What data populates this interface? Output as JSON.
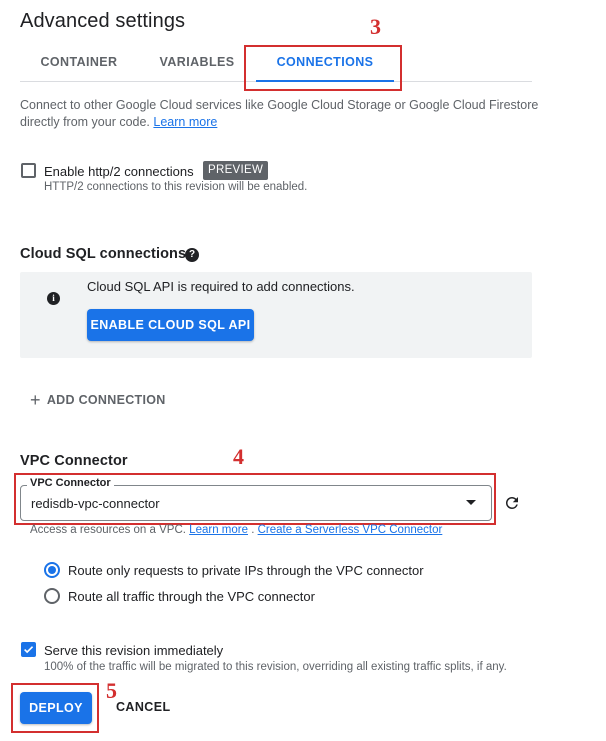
{
  "page": {
    "title": "Advanced settings"
  },
  "tabs": [
    {
      "label": "CONTAINER"
    },
    {
      "label": "VARIABLES"
    },
    {
      "label": "CONNECTIONS"
    }
  ],
  "connections": {
    "description": "Connect to other Google Cloud services like Google Cloud Storage or Google Cloud Firestore directly from your code.",
    "learn_more": "Learn more"
  },
  "http2": {
    "label": "Enable http/2 connections",
    "badge": "PREVIEW",
    "hint": "HTTP/2 connections to this revision will be enabled.",
    "checked": false
  },
  "cloud_sql": {
    "title": "Cloud SQL connections",
    "help_icon": "?",
    "info_icon": "i",
    "info_text": "Cloud SQL API is required to add connections.",
    "enable_button": "ENABLE CLOUD SQL API",
    "add_connection": "ADD CONNECTION",
    "add_icon": "+"
  },
  "vpc": {
    "title": "VPC Connector",
    "field_label": "VPC Connector",
    "value": "redisdb-vpc-connector",
    "help_prefix": "Access a resources on a VPC.",
    "learn_more": "Learn more",
    "separator": ".",
    "create_link": "Create a Serverless VPC Connector",
    "routing_options": [
      {
        "label": "Route only requests to private IPs through the VPC connector",
        "selected": true
      },
      {
        "label": "Route all traffic through the VPC connector",
        "selected": false
      }
    ]
  },
  "serve": {
    "label": "Serve this revision immediately",
    "hint": "100% of the traffic will be migrated to this revision, overriding all existing traffic splits, if any.",
    "checked": true
  },
  "actions": {
    "deploy": "DEPLOY",
    "cancel": "CANCEL"
  },
  "annotations": {
    "step_3": "3",
    "step_4": "4",
    "step_5": "5",
    "color": "#d32f2f"
  },
  "colors": {
    "accent": "#1a73e8",
    "text": "#202124",
    "muted": "#5f6368"
  }
}
